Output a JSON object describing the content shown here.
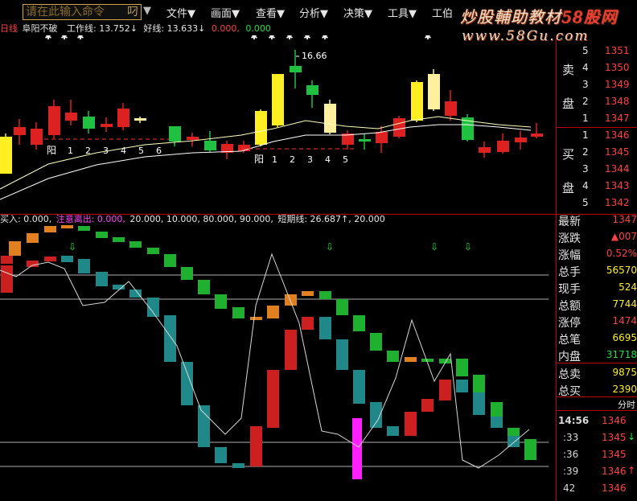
{
  "command_box": {
    "placeholder": "请在此输入命令",
    "shortcut": "叼"
  },
  "menu": [
    {
      "label": "文件▼"
    },
    {
      "label": "画面▼"
    },
    {
      "label": "查看▼"
    },
    {
      "label": "分析▼"
    },
    {
      "label": "决策▼"
    },
    {
      "label": "工具▼"
    },
    {
      "label": "工伯"
    }
  ],
  "scroll_arrow": "▼",
  "brand": {
    "line1_text": "炒股輔助教材",
    "line1_num": "58股网",
    "line2": "www.58Gu.com"
  },
  "indicator_bar": {
    "prefix": "日线",
    "title": "阜阳不破",
    "work_label": "工作线: 13.752↓",
    "good_label": "好线: 13.633↓",
    "v1": "0.000",
    "v2": "0.000"
  },
  "main_chart": {
    "peak_label": "16.66",
    "yang_label": "阳",
    "group1_numbers": [
      "1",
      "2",
      "3",
      "4",
      "5",
      "6"
    ],
    "group2_numbers": [
      "1",
      "2",
      "3",
      "4",
      "5"
    ],
    "colors": {
      "red": "#dd2020",
      "green": "#20c040",
      "yellow": "#ffee22",
      "cream": "#fff0a0",
      "white": "#ffffff"
    }
  },
  "sub_bar": {
    "buy_label": "买入: 0.000,",
    "attention_label": "注意离出: 0.000,",
    "vals": "20.000, 10.000, 80.000, 90.000,",
    "short_label": "短期线: 26.687↑, 20.000"
  },
  "order_book": {
    "sell_label": [
      "卖",
      "盘"
    ],
    "buy_label": [
      "买",
      "盘"
    ],
    "sell": [
      {
        "idx": "5",
        "price": "1351"
      },
      {
        "idx": "4",
        "price": "1350"
      },
      {
        "idx": "3",
        "price": "1349"
      },
      {
        "idx": "2",
        "price": "1348"
      },
      {
        "idx": "1",
        "price": "1347"
      }
    ],
    "buy": [
      {
        "idx": "1",
        "price": "1346"
      },
      {
        "idx": "2",
        "price": "1345"
      },
      {
        "idx": "3",
        "price": "1344"
      },
      {
        "idx": "4",
        "price": "1343"
      },
      {
        "idx": "5",
        "price": "1342"
      }
    ]
  },
  "stats": [
    {
      "label": "最新",
      "value": "1347",
      "color": "#ff4040"
    },
    {
      "label": "涨跌",
      "value": "▲007",
      "color": "#ff4040"
    },
    {
      "label": "涨幅",
      "value": "0.52%",
      "color": "#ff4040"
    },
    {
      "label": "总手",
      "value": "56570",
      "color": "#ffee22"
    },
    {
      "label": "现手",
      "value": "524",
      "color": "#ffee22"
    },
    {
      "label": "总额",
      "value": "7744",
      "color": "#ffee22"
    },
    {
      "label": "涨停",
      "value": "1474",
      "color": "#ff4040"
    },
    {
      "label": "总笔",
      "value": "6695",
      "color": "#ffee22"
    },
    {
      "label": "内盘",
      "value": "31718",
      "color": "#20e040"
    },
    {
      "label": "总卖",
      "value": "9875",
      "color": "#ffee22"
    },
    {
      "label": "总买",
      "value": "2390",
      "color": "#ffee22"
    }
  ],
  "fenshi_label": "分时",
  "ticks": [
    {
      "time": "14:56",
      "price": "1346",
      "arrow": ""
    },
    {
      "time": ":33",
      "price": "1345",
      "arrow": "↓"
    },
    {
      "time": ":36",
      "price": "1345",
      "arrow": ""
    },
    {
      "time": ":39",
      "price": "1346",
      "arrow": "↑"
    },
    {
      "time": "42",
      "price": "1346",
      "arrow": ""
    }
  ]
}
